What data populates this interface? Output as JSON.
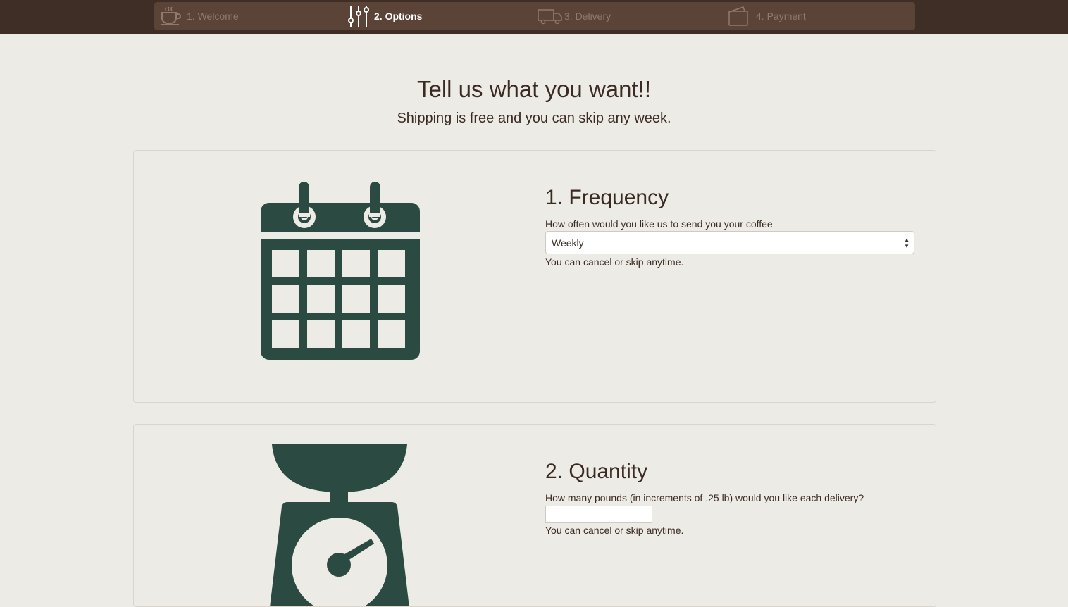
{
  "steps": [
    {
      "label": "1. Welcome",
      "icon": "coffee-cup-icon",
      "active": false
    },
    {
      "label": "2. Options",
      "icon": "sliders-icon",
      "active": true
    },
    {
      "label": "3. Delivery",
      "icon": "truck-icon",
      "active": false
    },
    {
      "label": "4. Payment",
      "icon": "wallet-icon",
      "active": false
    }
  ],
  "page": {
    "title": "Tell us what you want!!",
    "subtitle": "Shipping is free and you can skip any week."
  },
  "frequency": {
    "title": "1. Frequency",
    "label": "How often would you like us to send you your coffee",
    "selected": "Weekly",
    "help": "You can cancel or skip anytime.",
    "icon": "calendar-icon"
  },
  "quantity": {
    "title": "2. Quantity",
    "label": "How many pounds (in increments of .25 lb) would you like each delivery?",
    "value": "",
    "help": "You can cancel or skip anytime.",
    "icon": "scale-icon"
  },
  "colors": {
    "topbar": "#3f2e25",
    "nav": "#5b4337",
    "background": "#edebe6",
    "icon_green": "#2b4a42",
    "text": "#3b2a22"
  }
}
